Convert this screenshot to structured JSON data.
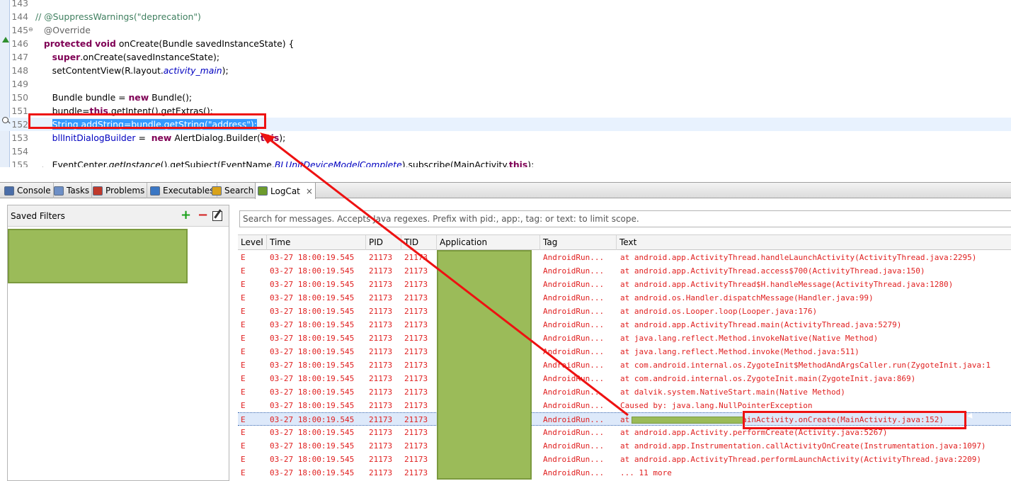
{
  "editor": {
    "lines": [
      {
        "num": "143",
        "parts": [
          {
            "t": "",
            "c": ""
          }
        ]
      },
      {
        "num": "144",
        "parts": [
          {
            "t": "// @SuppressWarnings(\"deprecation\")",
            "c": "cmt"
          }
        ]
      },
      {
        "num": "145",
        "parts": [
          {
            "t": "   @Override",
            "c": "ann"
          }
        ]
      },
      {
        "num": "146",
        "parts": [
          {
            "t": "   ",
            "c": ""
          },
          {
            "t": "protected",
            "c": "kw"
          },
          {
            "t": " ",
            "c": ""
          },
          {
            "t": "void",
            "c": "kw"
          },
          {
            "t": " onCreate(Bundle savedInstanceState) {",
            "c": ""
          }
        ]
      },
      {
        "num": "147",
        "parts": [
          {
            "t": "      ",
            "c": ""
          },
          {
            "t": "super",
            "c": "kw"
          },
          {
            "t": ".onCreate(savedInstanceState);",
            "c": ""
          }
        ]
      },
      {
        "num": "148",
        "parts": [
          {
            "t": "      setContentView(R.layout.",
            "c": ""
          },
          {
            "t": "activity_main",
            "c": "itfld"
          },
          {
            "t": ");",
            "c": ""
          }
        ]
      },
      {
        "num": "149",
        "parts": [
          {
            "t": "",
            "c": ""
          }
        ]
      },
      {
        "num": "150",
        "parts": [
          {
            "t": "      Bundle bundle = ",
            "c": ""
          },
          {
            "t": "new",
            "c": "kw"
          },
          {
            "t": " Bundle();",
            "c": ""
          }
        ]
      },
      {
        "num": "151",
        "parts": [
          {
            "t": "      bundle=",
            "c": ""
          },
          {
            "t": "this",
            "c": "kw"
          },
          {
            "t": ".getIntent().getExtras();",
            "c": ""
          }
        ]
      },
      {
        "num": "152",
        "parts": [
          {
            "t": "      ",
            "c": ""
          },
          {
            "t": "String addString=bundle.getString(\"address\");",
            "c": "sel"
          }
        ]
      },
      {
        "num": "153",
        "parts": [
          {
            "t": "      ",
            "c": ""
          },
          {
            "t": "bllInitDialogBuilder",
            "c": "fld"
          },
          {
            "t": " =  ",
            "c": ""
          },
          {
            "t": "new",
            "c": "kw"
          },
          {
            "t": " AlertDialog.Builder(",
            "c": ""
          },
          {
            "t": "this",
            "c": "kw"
          },
          {
            "t": ");",
            "c": ""
          }
        ]
      },
      {
        "num": "154",
        "parts": [
          {
            "t": "",
            "c": ""
          }
        ]
      },
      {
        "num": "155",
        "parts": [
          {
            "t": "      EventCenter.",
            "c": ""
          },
          {
            "t": "getInstance",
            "c": "it"
          },
          {
            "t": "().getSubject(EventName.",
            "c": ""
          },
          {
            "t": "BLUnitDeviceModelComplete",
            "c": "itfld"
          },
          {
            "t": ").subscribe(MainActivity.",
            "c": ""
          },
          {
            "t": "this",
            "c": "kw"
          },
          {
            "t": ");",
            "c": ""
          }
        ]
      }
    ]
  },
  "tabs": [
    {
      "label": "Console",
      "icon": "console-icon",
      "color": "#4a6da8"
    },
    {
      "label": "Tasks",
      "icon": "tasks-icon",
      "color": "#6d8fc6"
    },
    {
      "label": "Problems",
      "icon": "problems-icon",
      "color": "#c0392b"
    },
    {
      "label": "Executables",
      "icon": "executables-icon",
      "color": "#3a77c4"
    },
    {
      "label": "Search",
      "icon": "search-icon",
      "color": "#d8a21a"
    },
    {
      "label": "LogCat",
      "icon": "logcat-icon",
      "color": "#6d9b2d",
      "active": true
    }
  ],
  "logcat_tab_close": "×",
  "filters": {
    "title": "Saved Filters",
    "add": "+",
    "remove": "−"
  },
  "search": {
    "placeholder": "Search for messages. Accepts Java regexes. Prefix with pid:, app:, tag: or text: to limit scope."
  },
  "columns": {
    "level": "Level",
    "time": "Time",
    "pid": "PID",
    "tid": "TID",
    "application": "Application",
    "tag": "Tag",
    "text": "Text"
  },
  "log": [
    {
      "level": "E",
      "time": "03-27 18:00:19.545",
      "pid": "21173",
      "tid": "21173",
      "tag": "AndroidRun...",
      "text": "at android.app.ActivityThread.handleLaunchActivity(ActivityThread.java:2295)"
    },
    {
      "level": "E",
      "time": "03-27 18:00:19.545",
      "pid": "21173",
      "tid": "21173",
      "tag": "AndroidRun...",
      "text": "at android.app.ActivityThread.access$700(ActivityThread.java:150)"
    },
    {
      "level": "E",
      "time": "03-27 18:00:19.545",
      "pid": "21173",
      "tid": "21173",
      "tag": "AndroidRun...",
      "text": "at android.app.ActivityThread$H.handleMessage(ActivityThread.java:1280)"
    },
    {
      "level": "E",
      "time": "03-27 18:00:19.545",
      "pid": "21173",
      "tid": "21173",
      "tag": "AndroidRun...",
      "text": "at android.os.Handler.dispatchMessage(Handler.java:99)"
    },
    {
      "level": "E",
      "time": "03-27 18:00:19.545",
      "pid": "21173",
      "tid": "21173",
      "tag": "AndroidRun...",
      "text": "at android.os.Looper.loop(Looper.java:176)"
    },
    {
      "level": "E",
      "time": "03-27 18:00:19.545",
      "pid": "21173",
      "tid": "21173",
      "tag": "AndroidRun...",
      "text": "at android.app.ActivityThread.main(ActivityThread.java:5279)"
    },
    {
      "level": "E",
      "time": "03-27 18:00:19.545",
      "pid": "21173",
      "tid": "21173",
      "tag": "AndroidRun...",
      "text": "at java.lang.reflect.Method.invokeNative(Native Method)"
    },
    {
      "level": "E",
      "time": "03-27 18:00:19.545",
      "pid": "21173",
      "tid": "21173",
      "tag": "AndroidRun...",
      "text": "at java.lang.reflect.Method.invoke(Method.java:511)"
    },
    {
      "level": "E",
      "time": "03-27 18:00:19.545",
      "pid": "21173",
      "tid": "21173",
      "tag": "AndroidRun...",
      "text": "at com.android.internal.os.ZygoteInit$MethodAndArgsCaller.run(ZygoteInit.java:1"
    },
    {
      "level": "E",
      "time": "03-27 18:00:19.545",
      "pid": "21173",
      "tid": "21173",
      "tag": "AndroidRun...",
      "text": "at com.android.internal.os.ZygoteInit.main(ZygoteInit.java:869)"
    },
    {
      "level": "E",
      "time": "03-27 18:00:19.545",
      "pid": "21173",
      "tid": "21173",
      "tag": "AndroidRun...",
      "text": "at dalvik.system.NativeStart.main(Native Method)"
    },
    {
      "level": "E",
      "time": "03-27 18:00:19.545",
      "pid": "21173",
      "tid": "21173",
      "tag": "AndroidRun...",
      "text": "Caused by: java.lang.NullPointerException"
    },
    {
      "level": "E",
      "time": "03-27 18:00:19.545",
      "pid": "21173",
      "tid": "21173",
      "tag": "AndroidRun...",
      "text": "at                      .MainActivity.onCreate(MainActivity.java:152)",
      "selected": true
    },
    {
      "level": "E",
      "time": "03-27 18:00:19.545",
      "pid": "21173",
      "tid": "21173",
      "tag": "AndroidRun...",
      "text": "at android.app.Activity.performCreate(Activity.java:5267)"
    },
    {
      "level": "E",
      "time": "03-27 18:00:19.545",
      "pid": "21173",
      "tid": "21173",
      "tag": "AndroidRun...",
      "text": "at android.app.Instrumentation.callActivityOnCreate(Instrumentation.java:1097)"
    },
    {
      "level": "E",
      "time": "03-27 18:00:19.545",
      "pid": "21173",
      "tid": "21173",
      "tag": "AndroidRun...",
      "text": "at android.app.ActivityThread.performLaunchActivity(ActivityThread.java:2209)"
    },
    {
      "level": "E",
      "time": "03-27 18:00:19.545",
      "pid": "21173",
      "tid": "21173",
      "tag": "AndroidRun...",
      "text": "... 11 more"
    }
  ],
  "colors": {
    "error": "#e02020",
    "highlight": "#ee1111",
    "redaction": "#9bbb59",
    "selection": "#3399ff"
  }
}
